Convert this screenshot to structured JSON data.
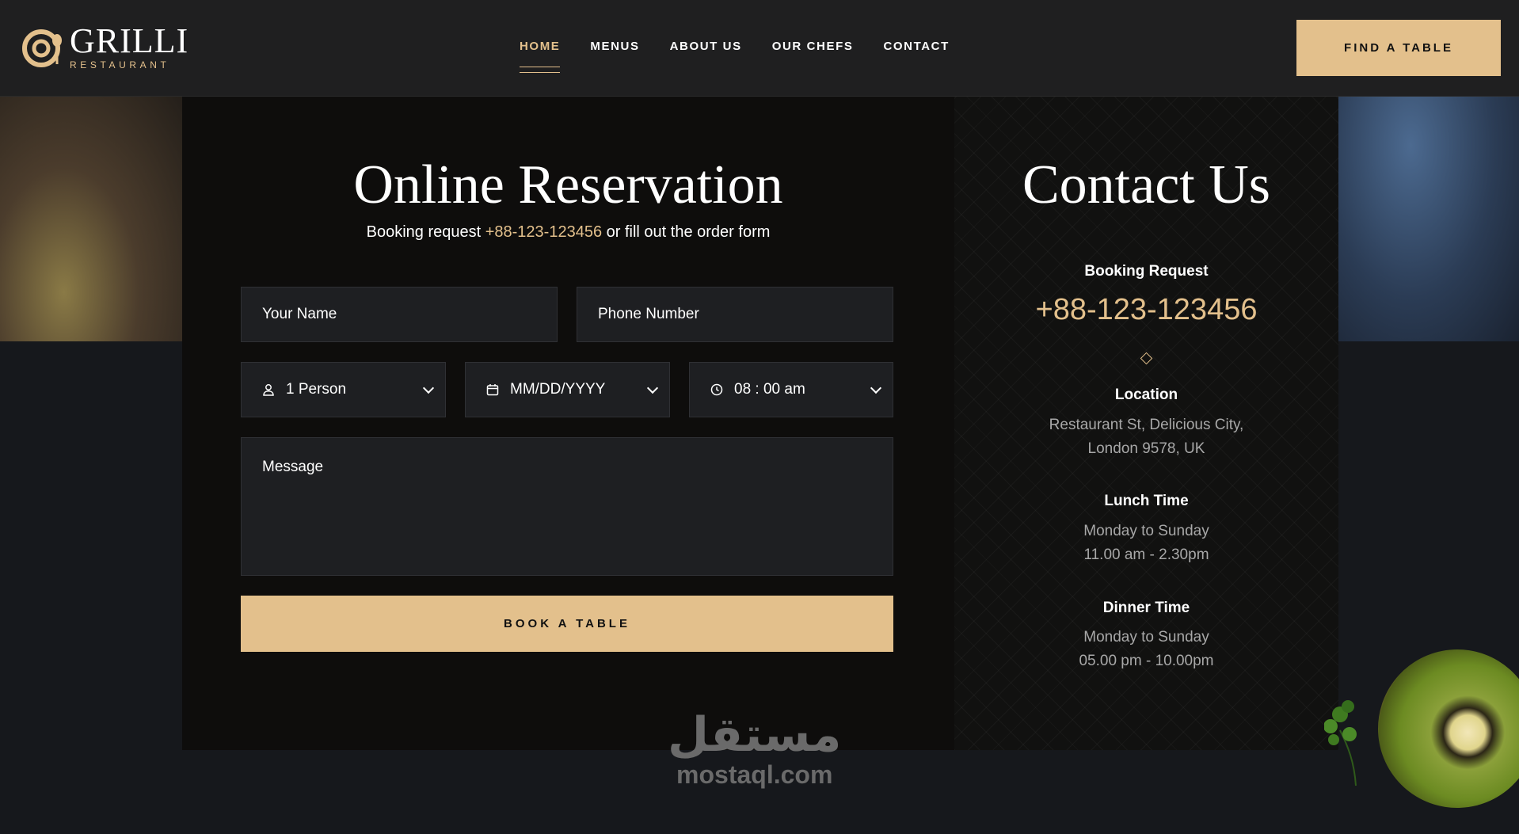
{
  "header": {
    "logo": {
      "title": "GRILLI",
      "subtitle": "RESTAURANT"
    },
    "nav": [
      {
        "label": "HOME",
        "active": true
      },
      {
        "label": "MENUS",
        "active": false
      },
      {
        "label": "ABOUT US",
        "active": false
      },
      {
        "label": "OUR CHEFS",
        "active": false
      },
      {
        "label": "CONTACT",
        "active": false
      }
    ],
    "cta_label": "FIND A TABLE"
  },
  "reservation": {
    "title": "Online Reservation",
    "subtitle_before": "Booking request ",
    "subtitle_phone": "+88-123-123456",
    "subtitle_after": " or fill out the order form",
    "name_placeholder": "Your Name",
    "phone_placeholder": "Phone Number",
    "person_value": "1 Person",
    "date_value": "MM/DD/YYYY",
    "time_value": "08 : 00 am",
    "message_placeholder": "Message",
    "submit_label": "BOOK A TABLE"
  },
  "contact": {
    "title": "Contact Us",
    "booking_label": "Booking Request",
    "booking_phone": "+88-123-123456",
    "location_label": "Location",
    "location_line1": "Restaurant St, Delicious City,",
    "location_line2": "London 9578, UK",
    "lunch_label": "Lunch Time",
    "lunch_line1": "Monday to Sunday",
    "lunch_line2": "11.00 am - 2.30pm",
    "dinner_label": "Dinner Time",
    "dinner_line1": "Monday to Sunday",
    "dinner_line2": "05.00 pm - 10.00pm"
  },
  "watermark": {
    "arabic": "مستقل",
    "latin": "mostaql.com"
  },
  "colors": {
    "accent": "#e3c08c",
    "panel": "#0e0d0c",
    "field": "#1e1f22",
    "header": "#1f1f20"
  }
}
